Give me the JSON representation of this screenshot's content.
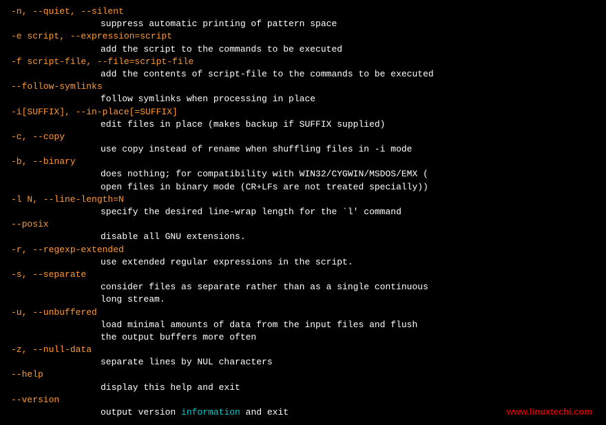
{
  "options": [
    {
      "name": "-n, --quiet, --silent",
      "desc": [
        "suppress automatic printing of pattern space"
      ]
    },
    {
      "name": "-e script, --expression=script",
      "desc": [
        "add the script to the commands to be executed"
      ]
    },
    {
      "name": "-f script-file, --file=script-file",
      "desc": [
        "add the contents of script-file to the commands to be executed"
      ]
    },
    {
      "name": "--follow-symlinks",
      "desc": [
        "follow symlinks when processing in place"
      ]
    },
    {
      "name": "-i[SUFFIX], --in-place[=SUFFIX]",
      "desc": [
        "edit files in place (makes backup if SUFFIX supplied)"
      ]
    },
    {
      "name": "-c, --copy",
      "desc": [
        "use copy instead of rename when shuffling files in -i mode"
      ]
    },
    {
      "name": "-b, --binary",
      "desc": [
        "does nothing; for compatibility with WIN32/CYGWIN/MSDOS/EMX (",
        "open files in binary mode (CR+LFs are not treated specially))"
      ]
    },
    {
      "name": "-l N, --line-length=N",
      "desc": [
        "specify the desired line-wrap length for the `l' command"
      ]
    },
    {
      "name": "--posix",
      "desc": [
        "disable all GNU extensions."
      ]
    },
    {
      "name": "-r, --regexp-extended",
      "desc": [
        "use extended regular expressions in the script."
      ]
    },
    {
      "name": "-s, --separate",
      "desc": [
        "consider files as separate rather than as a single continuous",
        "long stream."
      ]
    },
    {
      "name": "-u, --unbuffered",
      "desc": [
        "load minimal amounts of data from the input files and flush",
        "the output buffers more often"
      ]
    },
    {
      "name": "-z, --null-data",
      "desc": [
        "separate lines by NUL characters"
      ]
    },
    {
      "name": "--help",
      "desc": [
        "display this help and exit"
      ]
    },
    {
      "name": "--version",
      "desc_parts": [
        {
          "text": "output version ",
          "highlight": false
        },
        {
          "text": "information",
          "highlight": true
        },
        {
          "text": " and exit",
          "highlight": false
        }
      ]
    }
  ],
  "watermark": "www.linuxtechi.com"
}
